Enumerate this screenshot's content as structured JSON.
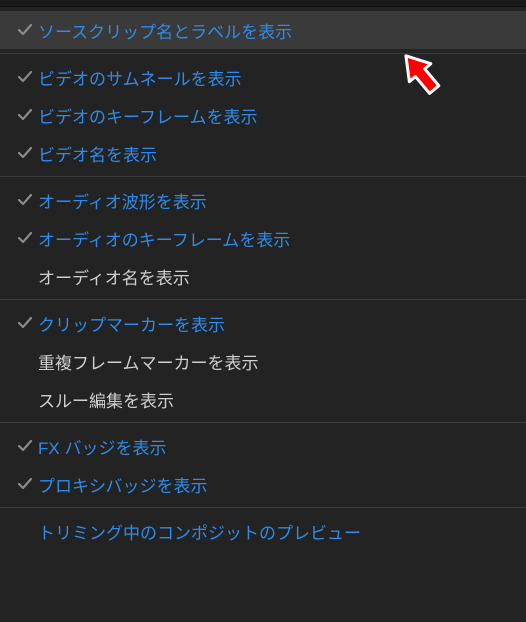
{
  "menu": {
    "groups": [
      [
        {
          "label": "ソースクリップ名とラベルを表示",
          "checked": true,
          "enabled": true,
          "highlight": true,
          "slug": "source-clip-name-label"
        }
      ],
      [
        {
          "label": "ビデオのサムネールを表示",
          "checked": true,
          "enabled": true,
          "highlight": false,
          "slug": "video-thumbnails"
        },
        {
          "label": "ビデオのキーフレームを表示",
          "checked": true,
          "enabled": true,
          "highlight": false,
          "slug": "video-keyframes"
        },
        {
          "label": "ビデオ名を表示",
          "checked": true,
          "enabled": true,
          "highlight": false,
          "slug": "video-names"
        }
      ],
      [
        {
          "label": "オーディオ波形を表示",
          "checked": true,
          "enabled": true,
          "highlight": false,
          "slug": "audio-waveform"
        },
        {
          "label": "オーディオのキーフレームを表示",
          "checked": true,
          "enabled": true,
          "highlight": false,
          "slug": "audio-keyframes"
        },
        {
          "label": "オーディオ名を表示",
          "checked": false,
          "enabled": false,
          "highlight": false,
          "slug": "audio-names"
        }
      ],
      [
        {
          "label": "クリップマーカーを表示",
          "checked": true,
          "enabled": true,
          "highlight": false,
          "slug": "clip-markers"
        },
        {
          "label": "重複フレームマーカーを表示",
          "checked": false,
          "enabled": false,
          "highlight": false,
          "slug": "duplicate-frame-markers"
        },
        {
          "label": "スルー編集を表示",
          "checked": false,
          "enabled": false,
          "highlight": false,
          "slug": "through-edits"
        }
      ],
      [
        {
          "label": "FX バッジを表示",
          "checked": true,
          "enabled": true,
          "highlight": false,
          "slug": "fx-badges"
        },
        {
          "label": "プロキシバッジを表示",
          "checked": true,
          "enabled": true,
          "highlight": false,
          "slug": "proxy-badges"
        }
      ],
      [
        {
          "label": "トリミング中のコンポジットのプレビュー",
          "checked": false,
          "enabled": true,
          "highlight": false,
          "slug": "composite-preview-trim"
        }
      ]
    ]
  }
}
